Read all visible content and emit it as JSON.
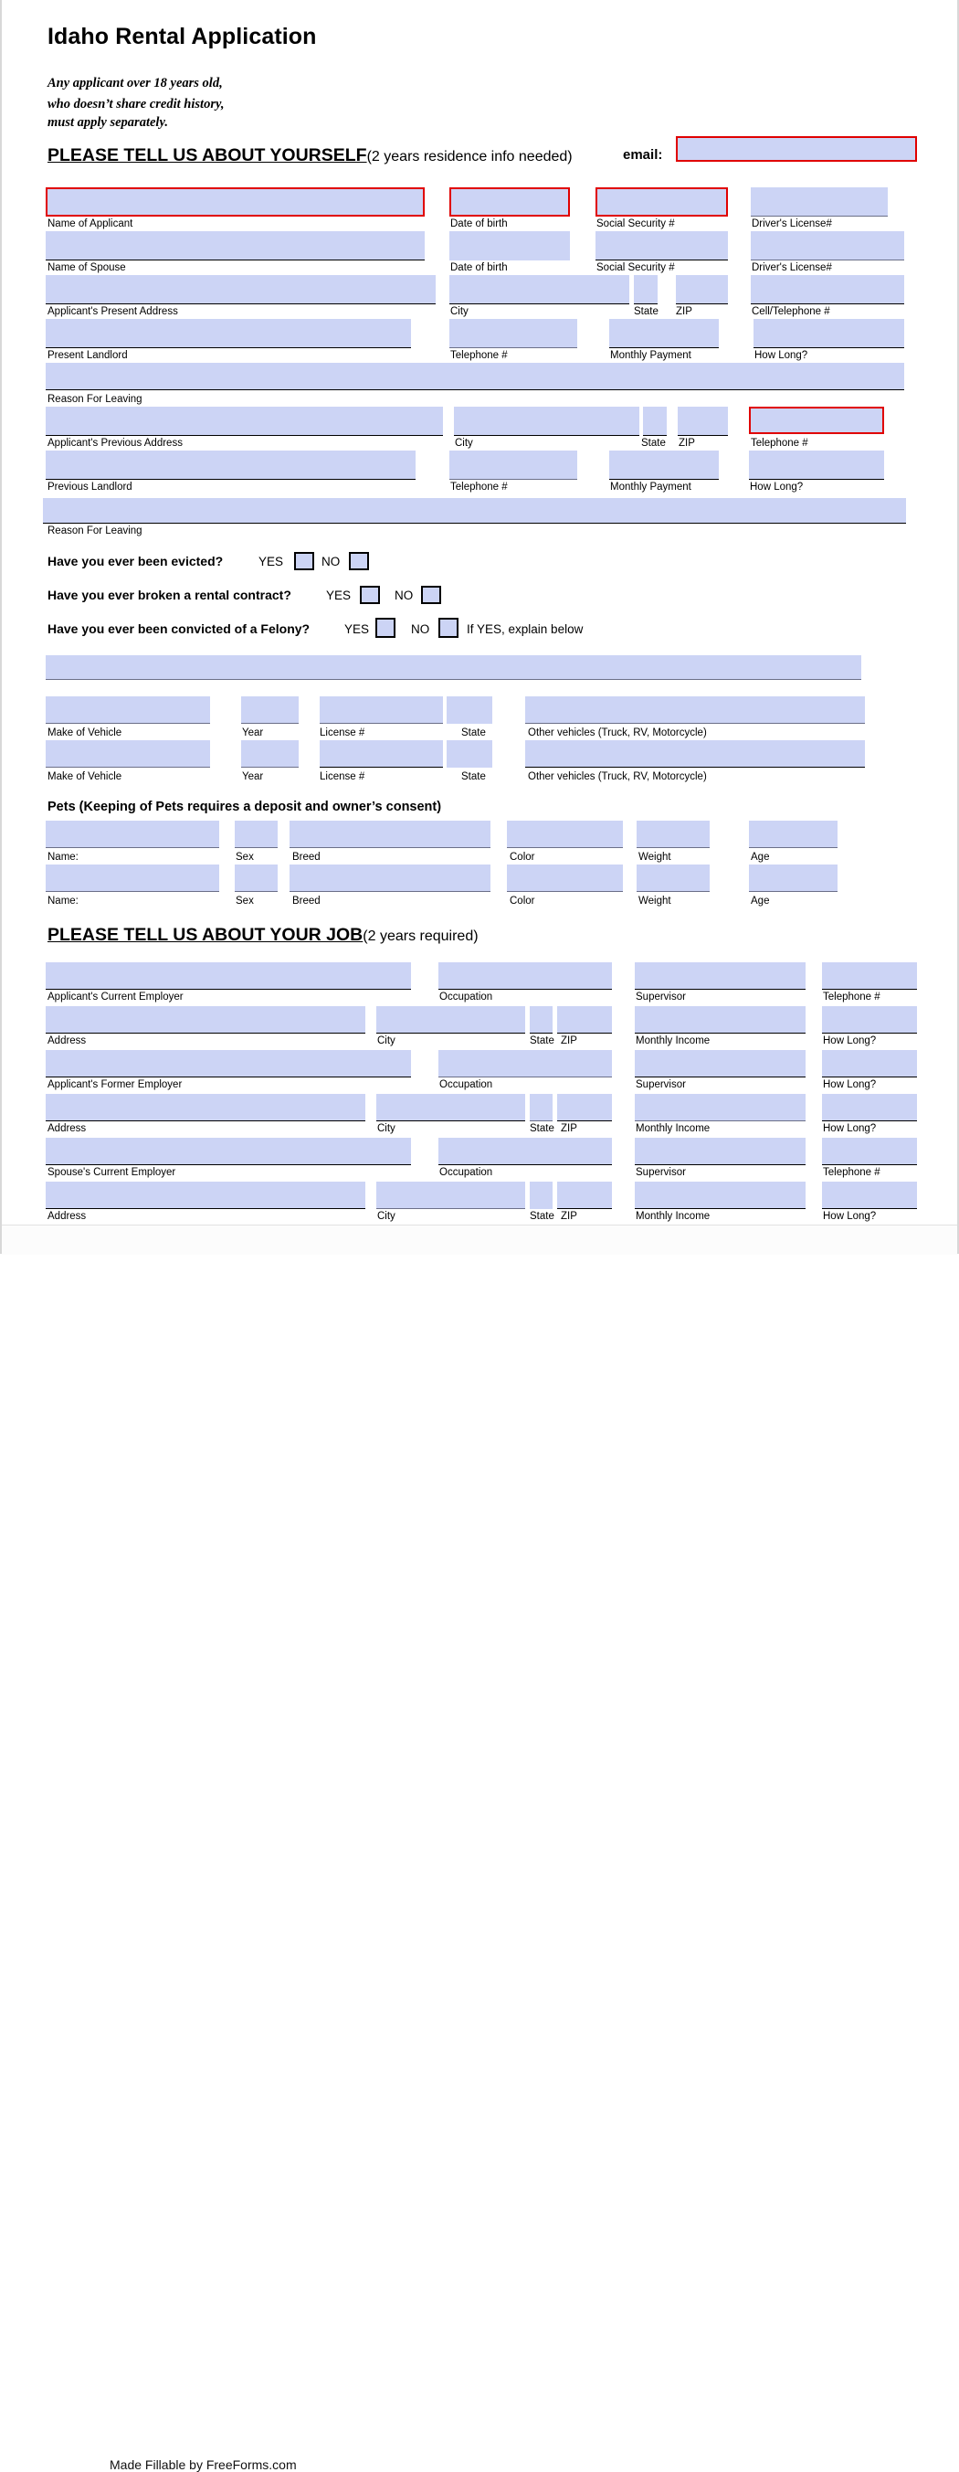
{
  "document": {
    "title": "Idaho Rental Application",
    "note_lines": [
      "Any applicant over 18 years old,",
      "who doesn’t share credit history,",
      "must apply separately."
    ],
    "footer": "Made Fillable by FreeForms.com"
  },
  "colors": {
    "field_fill": "#ccd4f5",
    "required_border": "#e00000",
    "rule": "#000000"
  },
  "section_yourself": {
    "heading": "PLEASE TELL US ABOUT YOURSELF",
    "heading_sub": "(2 years residence info needed)",
    "email_label": "email:",
    "email_value": "",
    "email_required": true,
    "labels": {
      "name_of_applicant": "Name of Applicant",
      "date_of_birth": "Date of birth",
      "social_security": "Social Security #",
      "drivers_license": "Driver's License#",
      "name_of_spouse": "Name of Spouse",
      "present_address": "Applicant's Present Address",
      "city": "City",
      "state": "State",
      "zip": "ZIP",
      "cell_telephone": "Cell/Telephone #",
      "present_landlord": "Present Landlord",
      "telephone": "Telephone #",
      "monthly_payment": "Monthly Payment",
      "how_long": "How Long?",
      "reason_for_leaving": "Reason For Leaving",
      "previous_address": "Applicant's Previous Address",
      "previous_landlord": "Previous Landlord"
    },
    "values": {
      "name_of_applicant": "",
      "applicant_dob": "",
      "applicant_ssn": "",
      "applicant_dl": "",
      "name_of_spouse": "",
      "spouse_dob": "",
      "spouse_ssn": "",
      "spouse_dl": "",
      "present_address": "",
      "present_city": "",
      "present_state": "",
      "present_zip": "",
      "cell_telephone": "",
      "present_landlord": "",
      "present_landlord_phone": "",
      "present_monthly_payment": "",
      "present_how_long": "",
      "reason_for_leaving_1": "",
      "previous_address": "",
      "previous_city": "",
      "previous_state": "",
      "previous_zip": "",
      "previous_telephone": "",
      "previous_landlord": "",
      "previous_landlord_phone": "",
      "previous_monthly_payment": "",
      "previous_how_long": "",
      "reason_for_leaving_2": ""
    }
  },
  "questions": [
    {
      "text": "Have you ever been evicted?",
      "yes_label": "YES",
      "no_label": "NO",
      "yes_checked": false,
      "no_checked": false,
      "hint": ""
    },
    {
      "text": "Have you ever broken a rental contract?",
      "yes_label": "YES",
      "no_label": "NO",
      "yes_checked": false,
      "no_checked": false,
      "hint": ""
    },
    {
      "text": "Have you ever been convicted of a Felony?",
      "yes_label": "YES",
      "no_label": "NO",
      "yes_checked": false,
      "no_checked": false,
      "hint": "If YES, explain below"
    }
  ],
  "explain_value": "",
  "vehicles": {
    "labels": {
      "make": "Make of Vehicle",
      "year": "Year",
      "license": "License #",
      "state": "State",
      "other": "Other vehicles (Truck, RV, Motorcycle)"
    },
    "rows": [
      {
        "make": "",
        "year": "",
        "license": "",
        "state": "",
        "other": ""
      },
      {
        "make": "",
        "year": "",
        "license": "",
        "state": "",
        "other": ""
      }
    ]
  },
  "pets": {
    "heading": "Pets  (Keeping of Pets requires a deposit and owner’s consent)",
    "labels": {
      "name": "Name:",
      "sex": "Sex",
      "breed": "Breed",
      "color": "Color",
      "weight": "Weight",
      "age": "Age"
    },
    "rows": [
      {
        "name": "",
        "sex": "",
        "breed": "",
        "color": "",
        "weight": "",
        "age": ""
      },
      {
        "name": "",
        "sex": "",
        "breed": "",
        "color": "",
        "weight": "",
        "age": ""
      }
    ]
  },
  "section_job": {
    "heading": "PLEASE TELL US ABOUT YOUR JOB",
    "heading_sub": "(2 years required)",
    "labels": {
      "current_employer": "Applicant's Current Employer",
      "occupation": "Occupation",
      "supervisor": "Supervisor",
      "telephone": "Telephone #",
      "address": "Address",
      "city": "City",
      "state": "State",
      "zip": "ZIP",
      "monthly_income": "Monthly Income",
      "how_long": "How Long?",
      "former_employer": "Applicant's  Former Employer",
      "spouse_employer": "Spouse's Current Employer"
    },
    "values": {
      "current_employer": "",
      "current_occupation": "",
      "current_supervisor": "",
      "current_telephone": "",
      "current_address": "",
      "current_city": "",
      "current_state": "",
      "current_zip": "",
      "current_monthly_income": "",
      "current_how_long": "",
      "former_employer": "",
      "former_occupation": "",
      "former_supervisor": "",
      "former_how_long_top": "",
      "former_address": "",
      "former_city": "",
      "former_state": "",
      "former_zip": "",
      "former_monthly_income": "",
      "former_how_long": "",
      "spouse_employer": "",
      "spouse_occupation": "",
      "spouse_supervisor": "",
      "spouse_telephone": "",
      "spouse_address": "",
      "spouse_city": "",
      "spouse_state": "",
      "spouse_zip": "",
      "spouse_monthly_income": "",
      "spouse_how_long": ""
    }
  }
}
